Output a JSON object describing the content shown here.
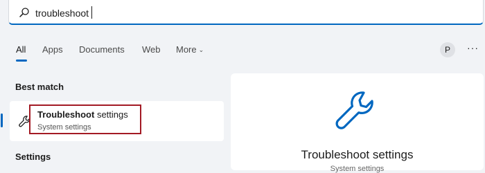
{
  "search": {
    "query": "troubleshoot"
  },
  "tabs": [
    {
      "label": "All"
    },
    {
      "label": "Apps"
    },
    {
      "label": "Documents"
    },
    {
      "label": "Web"
    },
    {
      "label": "More"
    }
  ],
  "user": {
    "avatar_initial": "P"
  },
  "menu": {
    "more_options": "···"
  },
  "best_match": {
    "section_title": "Best match",
    "result": {
      "title_bold": "Troubleshoot",
      "title_rest": " settings",
      "subtitle": "System settings",
      "icon": "wrench-icon"
    }
  },
  "settings_section": {
    "title": "Settings"
  },
  "preview": {
    "title": "Troubleshoot settings",
    "subtitle": "System settings",
    "icon": "wrench-icon"
  },
  "colors": {
    "accent": "#0067c0",
    "highlight_border": "#a31a24"
  }
}
